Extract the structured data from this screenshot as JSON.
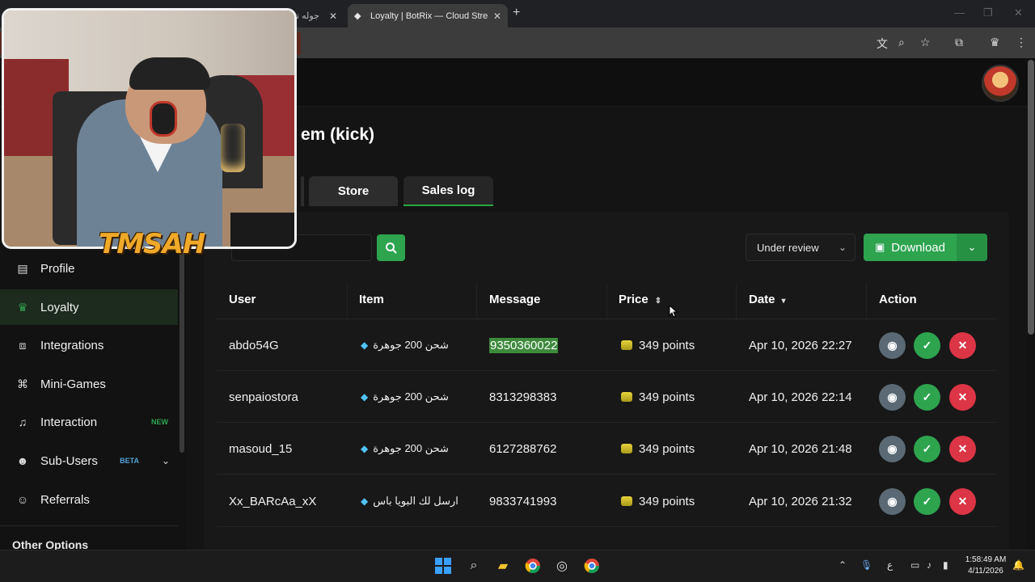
{
  "browser": {
    "tabs": [
      {
        "label": "جوله تش",
        "active": false
      },
      {
        "label": "Loyalty | BotRix — Cloud Stream",
        "active": true
      }
    ],
    "new_tab": "+"
  },
  "page": {
    "title_fragment": "em (kick)",
    "tabs": [
      {
        "label": "Store"
      },
      {
        "label": "Sales log"
      }
    ]
  },
  "toolbar": {
    "search_placeholder": "",
    "filter_selected": "Under review",
    "download_label": "Download"
  },
  "table": {
    "columns": [
      "User",
      "Item",
      "Message",
      "Price",
      "Date",
      "Action"
    ],
    "rows": [
      {
        "user": "abdo54G",
        "item": "شحن 200 جوهرة",
        "message": "9350360022",
        "price": "349 points",
        "date": "Apr 10, 2026 22:27"
      },
      {
        "user": "senpaiostora",
        "item": "شحن 200 جوهرة",
        "message": "8313298383",
        "price": "349 points",
        "date": "Apr 10, 2026 22:14"
      },
      {
        "user": "masoud_15",
        "item": "شحن 200 جوهرة",
        "message": "6127288762",
        "price": "349 points",
        "date": "Apr 10, 2026 21:48"
      },
      {
        "user": "Xx_BARcAa_xX",
        "item": "ارسل لك البويا باس",
        "message": "9833741993",
        "price": "349 points",
        "date": "Apr 10, 2026 21:32"
      }
    ]
  },
  "sidebar": {
    "items": [
      {
        "label": "Profile",
        "icon": "id-card-icon"
      },
      {
        "label": "Loyalty",
        "icon": "trophy-icon",
        "active": true
      },
      {
        "label": "Integrations",
        "icon": "integration-icon"
      },
      {
        "label": "Mini-Games",
        "icon": "gamepad-icon"
      },
      {
        "label": "Interaction",
        "icon": "music-icon",
        "badge": "NEW"
      },
      {
        "label": "Sub-Users",
        "icon": "users-icon",
        "badge": "BETA"
      },
      {
        "label": "Referrals",
        "icon": "referrals-icon"
      }
    ],
    "section_title": "Other Options"
  },
  "overlay": {
    "brand": "TMSAH"
  },
  "taskbar": {
    "time": "1:58:49 AM",
    "date": "4/11/2026",
    "lang": "ع"
  },
  "colors": {
    "accent_green": "#2ea44f",
    "danger_red": "#dc3545",
    "view_gray": "#5a6973",
    "background": "#121212"
  }
}
